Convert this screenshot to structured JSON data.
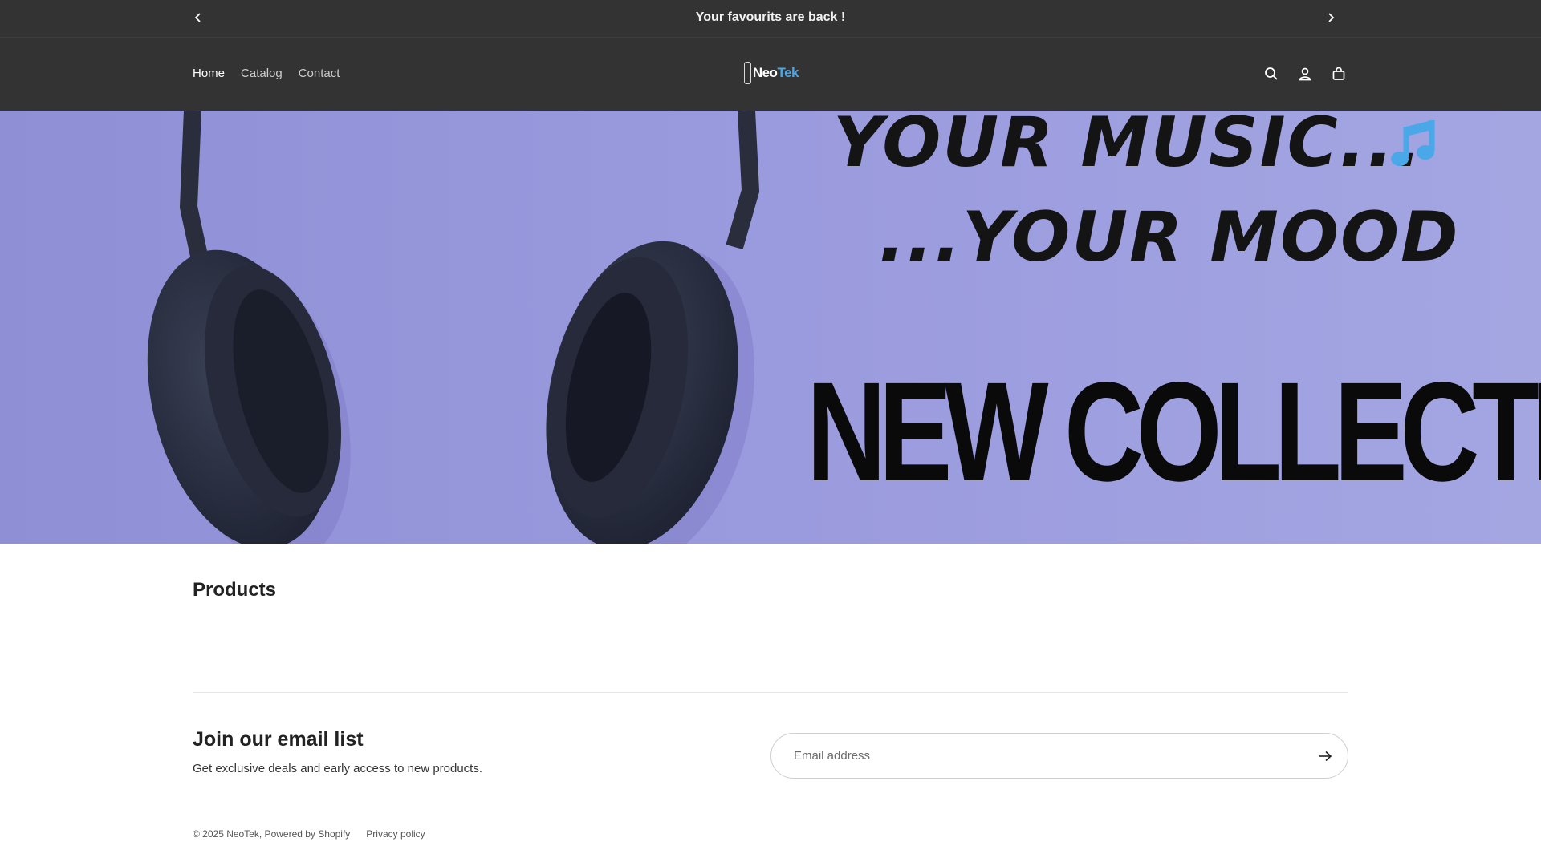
{
  "announcement": {
    "message": "Your favourits are back !",
    "prev_icon": "chevron-left-icon",
    "next_icon": "chevron-right-icon"
  },
  "header": {
    "nav": [
      {
        "label": "Home",
        "active": true
      },
      {
        "label": "Catalog",
        "active": false
      },
      {
        "label": "Contact",
        "active": false
      }
    ],
    "logo": {
      "neo": "Neo",
      "tek": "Tek"
    },
    "icons": [
      "search-icon",
      "account-icon",
      "cart-icon"
    ]
  },
  "hero": {
    "line1": "YOUR MUSIC...",
    "line2": "...YOUR MOOD",
    "line3": "NEW COLLECTION"
  },
  "products": {
    "title": "Products"
  },
  "newsletter": {
    "title": "Join our email list",
    "subtitle": "Get exclusive deals and early access to new products.",
    "email_placeholder": "Email address",
    "submit_icon": "arrow-right-icon"
  },
  "footer": {
    "copyright": "© 2025 NeoTek, Powered by Shopify",
    "privacy": "Privacy policy"
  },
  "colors": {
    "header_bg": "#333333",
    "hero_bg": "#9a9ade",
    "accent_blue": "#4aa8e8"
  }
}
